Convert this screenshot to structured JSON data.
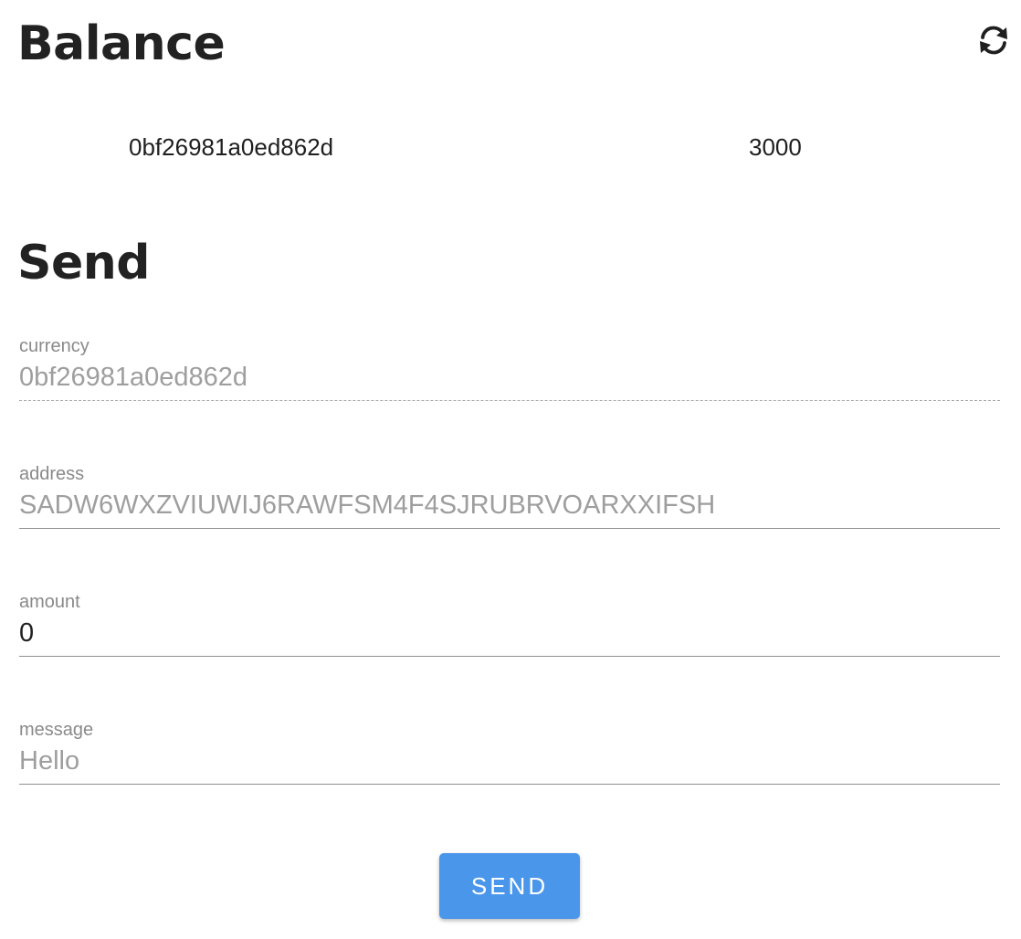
{
  "balance": {
    "title": "Balance",
    "refresh_icon": "refresh-icon",
    "rows": [
      {
        "currency": "0bf26981a0ed862d",
        "amount": "3000"
      }
    ]
  },
  "send": {
    "title": "Send",
    "fields": {
      "currency": {
        "label": "currency",
        "value": "0bf26981a0ed862d"
      },
      "address": {
        "label": "address",
        "placeholder": "SADW6WXZVIUWIJ6RAWFSM4F4SJRUBRVOARXXIFSH"
      },
      "amount": {
        "label": "amount",
        "value": "0"
      },
      "message": {
        "label": "message",
        "placeholder": "Hello"
      }
    },
    "submit_label": "SEND"
  },
  "colors": {
    "accent": "#4a96ea",
    "heading": "#222222",
    "label": "#8a8a8a",
    "placeholder": "#9e9e9e"
  }
}
